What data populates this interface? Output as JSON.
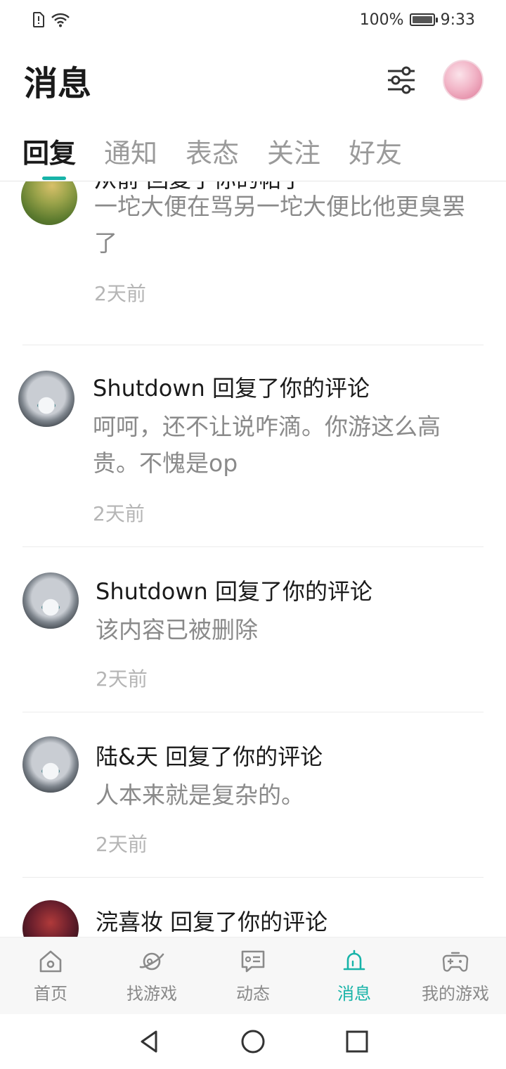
{
  "status_bar": {
    "battery_percent": "100%",
    "time": "9:33"
  },
  "header": {
    "title": "消息"
  },
  "tabs": [
    {
      "label": "回复",
      "active": true
    },
    {
      "label": "通知",
      "active": false
    },
    {
      "label": "表态",
      "active": false
    },
    {
      "label": "关注",
      "active": false
    },
    {
      "label": "好友",
      "active": false
    }
  ],
  "messages": [
    {
      "title": "从前 回复了你的帖子",
      "body": "一坨大便在骂另一坨大便比他更臭罢了",
      "time": "2天前"
    },
    {
      "title": "Shutdown 回复了你的评论",
      "body": "呵呵，还不让说咋滴。你游这么高贵。不愧是op",
      "time": "2天前"
    },
    {
      "title": "Shutdown 回复了你的评论",
      "body": "该内容已被删除",
      "time": "2天前"
    },
    {
      "title": "陆&天 回复了你的评论",
      "body": "人本来就是复杂的。",
      "time": "2天前"
    },
    {
      "title": "浣喜妆 回复了你的评论",
      "body": "",
      "time": ""
    }
  ],
  "bottom_nav": [
    {
      "label": "首页",
      "icon": "home-icon",
      "active": false
    },
    {
      "label": "找游戏",
      "icon": "planet-icon",
      "active": false
    },
    {
      "label": "动态",
      "icon": "feed-icon",
      "active": false
    },
    {
      "label": "消息",
      "icon": "bell-icon",
      "active": true
    },
    {
      "label": "我的游戏",
      "icon": "gamepad-icon",
      "active": false
    }
  ],
  "colors": {
    "accent": "#17b3a8",
    "text_primary": "#1a1a1a",
    "text_secondary": "#8a8a8a",
    "text_time": "#b5b5b5"
  }
}
